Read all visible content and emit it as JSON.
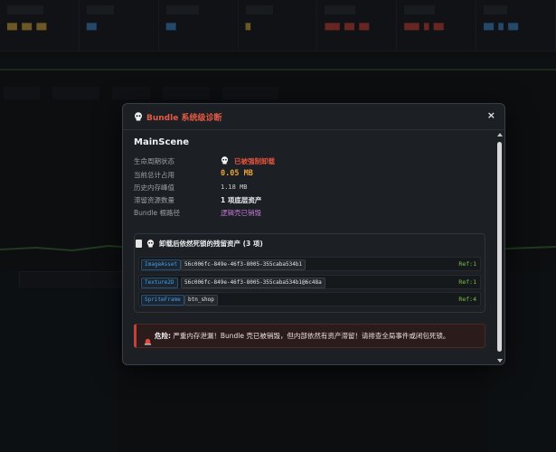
{
  "modal": {
    "title": "Bundle 系统级诊断",
    "close_label": "×",
    "scene_name": "MainScene",
    "fields": [
      {
        "label": "生命周期状态",
        "value": "已被强制卸载"
      },
      {
        "label": "当前总计占用",
        "value": "0.05 MB"
      },
      {
        "label": "历史内存峰值",
        "value": "1.18 MB"
      },
      {
        "label": "滞留资源数量",
        "value": "1 项底层资产"
      },
      {
        "label": "Bundle 根路径",
        "value": "逻辑壳已销毁"
      }
    ],
    "residual": {
      "heading": "卸载后依然死锁的残留资产 (3 项)",
      "items": [
        {
          "type": "ImageAsset",
          "id": "56c006fc-849e-46f3-8005-355caba534b1",
          "ref": "Ref:1"
        },
        {
          "type": "Texture2D",
          "id": "56c006fc-849e-46f3-8005-355caba534b1@6c48a",
          "ref": "Ref:1"
        },
        {
          "type": "SpriteFrame",
          "id": "btn_shop",
          "ref": "Ref:4"
        }
      ]
    },
    "alert": {
      "title": "危险:",
      "text": "严重内存泄漏！Bundle 壳已被销毁，但内部依然有资产滞留！请排查全局事件或闭包死锁。"
    }
  },
  "colors": {
    "danger": "#e4533f",
    "warning": "#e9a23b",
    "ref_green": "#7bc143",
    "tag_blue": "#4a9be0",
    "path_purple": "#c37ad8"
  },
  "icons": {
    "title": "skull-icon",
    "state": "skull-icon",
    "heading_doc": "document-icon",
    "heading_skull": "skull-icon",
    "alert": "siren-icon"
  }
}
